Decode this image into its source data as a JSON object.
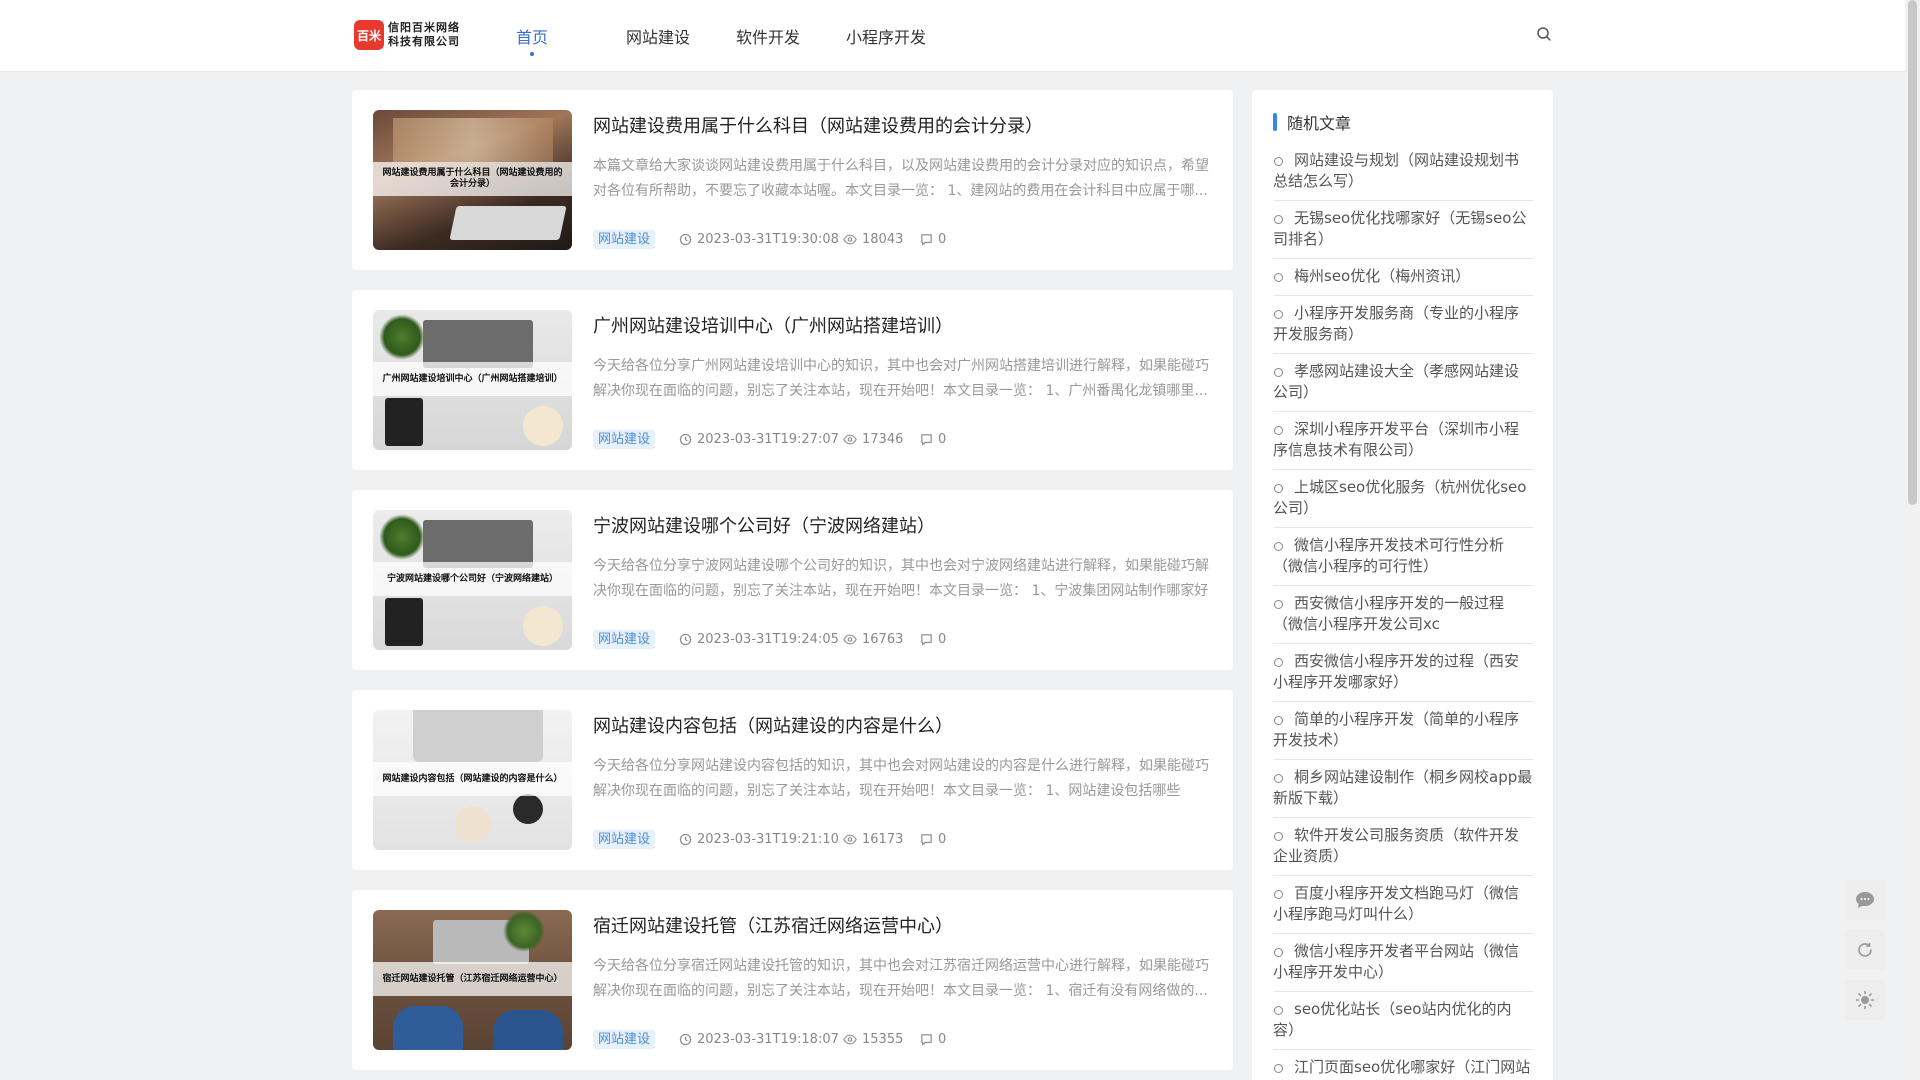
{
  "header": {
    "logo_mark": "百米",
    "logo_line1": "信阳百米网络",
    "logo_line2": "科技有限公司",
    "nav": [
      {
        "label": "首页",
        "active": true
      },
      {
        "label": "网站建设",
        "active": false
      },
      {
        "label": "软件开发",
        "active": false
      },
      {
        "label": "小程序开发",
        "active": false
      }
    ]
  },
  "articles": [
    {
      "title": "网站建设费用属于什么科目（网站建设费用的会计分录）",
      "excerpt": "本篇文章给大家谈谈网站建设费用属于什么科目，以及网站建设费用的会计分录对应的知识点，希望对各位有所帮助，不要忘了收藏本站喔。本文目录一览： 1、建网站的费用在会计科目中应属于哪...",
      "thumb_text": "网站建设费用属于什么科目（网站建设费用的会计分录）",
      "tag": "网站建设",
      "date": "2023-03-31T19:30:08",
      "views": "18043",
      "comments": "0"
    },
    {
      "title": "广州网站建设培训中心（广州网站搭建培训）",
      "excerpt": "今天给各位分享广州网站建设培训中心的知识，其中也会对广州网站搭建培训进行解释，如果能碰巧解决你现在面临的问题，别忘了关注本站，现在开始吧！本文目录一览： 1、广州番禺化龙镇哪里...",
      "thumb_text": "广州网站建设培训中心（广州网站搭建培训）",
      "tag": "网站建设",
      "date": "2023-03-31T19:27:07",
      "views": "17346",
      "comments": "0"
    },
    {
      "title": "宁波网站建设哪个公司好（宁波网络建站）",
      "excerpt": "今天给各位分享宁波网站建设哪个公司好的知识，其中也会对宁波网络建站进行解释，如果能碰巧解决你现在面临的问题，别忘了关注本站，现在开始吧！本文目录一览： 1、宁波集团网站制作哪家好",
      "thumb_text": "宁波网站建设哪个公司好（宁波网络建站）",
      "tag": "网站建设",
      "date": "2023-03-31T19:24:05",
      "views": "16763",
      "comments": "0"
    },
    {
      "title": "网站建设内容包括（网站建设的内容是什么）",
      "excerpt": "今天给各位分享网站建设内容包括的知识，其中也会对网站建设的内容是什么进行解释，如果能碰巧解决你现在面临的问题，别忘了关注本站，现在开始吧！本文目录一览： 1、网站建设包括哪些",
      "thumb_text": "网站建设内容包括（网站建设的内容是什么）",
      "tag": "网站建设",
      "date": "2023-03-31T19:21:10",
      "views": "16173",
      "comments": "0"
    },
    {
      "title": "宿迁网站建设托管（江苏宿迁网络运营中心）",
      "excerpt": "今天给各位分享宿迁网站建设托管的知识，其中也会对江苏宿迁网络运营中心进行解释，如果能碰巧解决你现在面临的问题，别忘了关注本站，现在开始吧！本文目录一览： 1、宿迁有没有网络做的...",
      "thumb_text": "宿迁网站建设托管（江苏宿迁网络运营中心）",
      "tag": "网站建设",
      "date": "2023-03-31T19:18:07",
      "views": "15355",
      "comments": "0"
    }
  ],
  "sidebar": {
    "title": "随机文章",
    "items": [
      "网站建设与规划（网站建设规划书总结怎么写）",
      "无锡seo优化找哪家好（无锡seo公司排名）",
      "梅州seo优化（梅州资讯）",
      "小程序开发服务商（专业的小程序开发服务商）",
      "孝感网站建设大全（孝感网站建设公司）",
      "深圳小程序开发平台（深圳市小程序信息技术有限公司）",
      "上城区seo优化服务（杭州优化seo公司）",
      "微信小程序开发技术可行性分析（微信小程序的可行性）",
      "西安微信小程序开发的一般过程（微信小程序开发公司xc",
      "西安微信小程序开发的过程（西安小程序开发哪家好）",
      "简单的小程序开发（简单的小程序开发技术）",
      "桐乡网站建设制作（桐乡网校app最新版下载）",
      "软件开发公司服务资质（软件开发企业资质）",
      "百度小程序开发文档跑马灯（微信小程序跑马灯叫什么）",
      "微信小程序开发者平台网站（微信小程序开发中心）",
      "seo优化站长（seo站内优化的内容）",
      "江门页面seo优化哪家好（江门网站"
    ]
  },
  "colors": {
    "accent": "#3a6fc6",
    "tag_bg": "#e6f1fb",
    "tag_text": "#4a8ed8",
    "page_bg": "#f0f1f3"
  }
}
